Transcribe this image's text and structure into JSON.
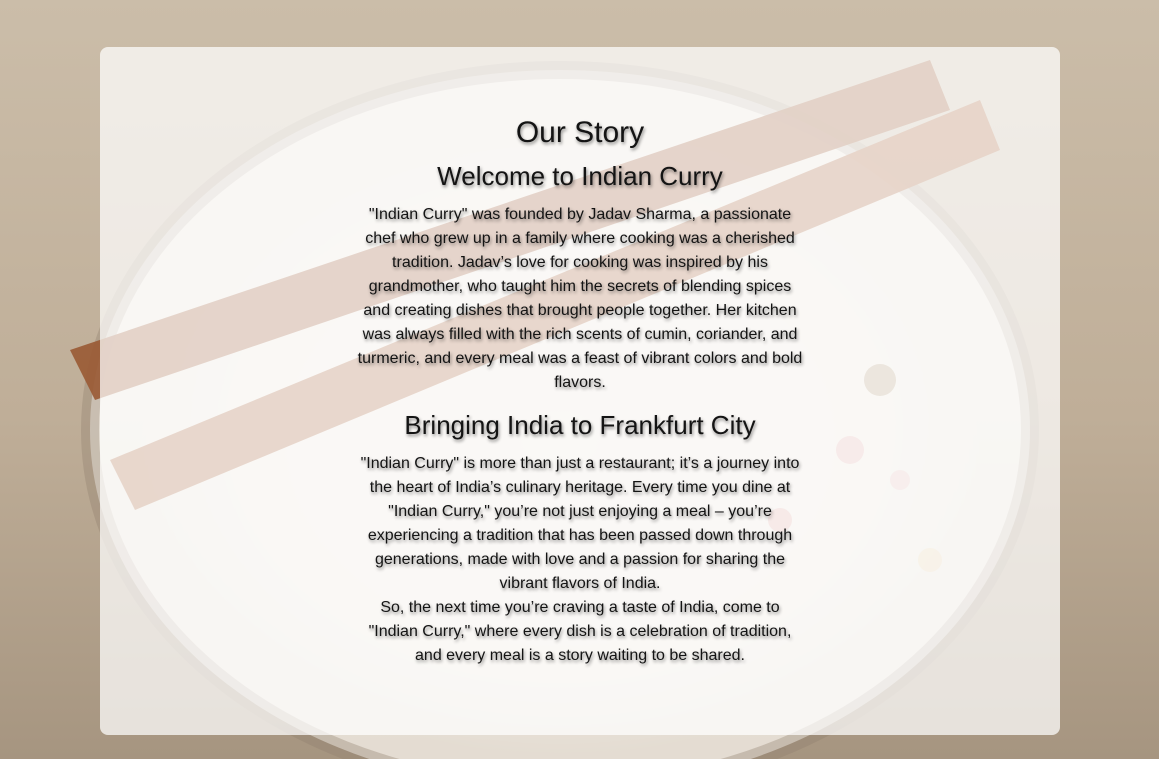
{
  "colors": {
    "panel": "rgba(255,255,255,0.72)",
    "text": "#141414",
    "background": "#cbbda9"
  },
  "page": {
    "title": "Our Story",
    "sections": [
      {
        "heading": "Welcome to Indian Curry",
        "paragraphs": [
          "\"Indian Curry\" was founded by Jadav Sharma, a passionate chef who grew up in a family where cooking was a cherished tradition. Jadav’s love for cooking was inspired by his grandmother, who taught him the secrets of blending spices and creating dishes that brought people together. Her kitchen was always filled with the rich scents of cumin, coriander, and turmeric, and every meal was a feast of vibrant colors and bold flavors."
        ]
      },
      {
        "heading": "Bringing India to Frankfurt City",
        "paragraphs": [
          "\"Indian Curry\" is more than just a restaurant; it’s a journey into the heart of India’s culinary heritage. Every time you dine at \"Indian Curry,\" you’re not just enjoying a meal – you’re experiencing a tradition that has been passed down through generations, made with love and a passion for sharing the vibrant flavors of India.",
          "So, the next time you’re craving a taste of India, come to \"Indian Curry,\" where every dish is a celebration of tradition, and every meal is a story waiting to be shared."
        ]
      }
    ]
  }
}
